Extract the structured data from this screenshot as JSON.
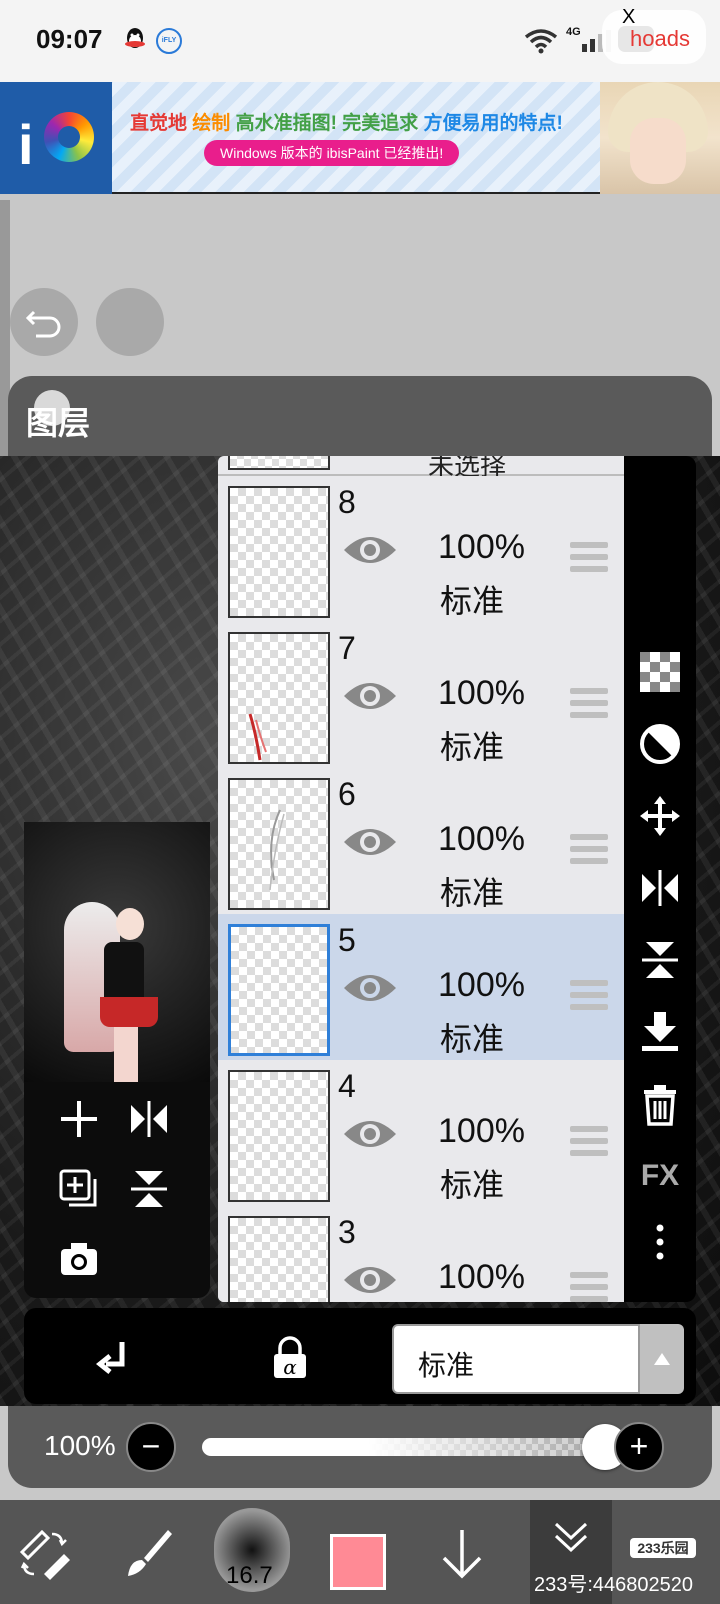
{
  "status_bar": {
    "time": "09:07",
    "network": "4G",
    "ad_close": "X",
    "ad_label": "hoads"
  },
  "ad_banner": {
    "headline_parts": [
      "直觉地",
      "绘制",
      "高水准插图!",
      "完美追求",
      "方便易用的特点!"
    ],
    "subline": "Windows 版本的 ibisPaint 已经推出!",
    "logo_letters": "iP"
  },
  "layer_panel": {
    "title": "图层",
    "top_partial_label": "未选择",
    "layers": [
      {
        "number": "8",
        "opacity": "100%",
        "blend": "标准",
        "selected": false
      },
      {
        "number": "7",
        "opacity": "100%",
        "blend": "标准",
        "selected": false
      },
      {
        "number": "6",
        "opacity": "100%",
        "blend": "标准",
        "selected": false
      },
      {
        "number": "5",
        "opacity": "100%",
        "blend": "标准",
        "selected": true
      },
      {
        "number": "4",
        "opacity": "100%",
        "blend": "标准",
        "selected": false
      },
      {
        "number": "3",
        "opacity": "100%",
        "blend": "标准",
        "selected": false
      }
    ],
    "right_tools": [
      "checker-icon",
      "half-circle-icon",
      "move-icon",
      "flip-horizontal-icon",
      "flip-vertical-icon",
      "merge-down-icon",
      "trash-icon",
      "fx-icon",
      "more-icon"
    ],
    "fx_label": "FX",
    "left_tools": [
      "add-layer-icon",
      "flip-layer-horizontal-icon",
      "duplicate-layer-icon",
      "flip-layer-vertical-icon",
      "camera-icon"
    ]
  },
  "blend_bar": {
    "blend_mode": "标准"
  },
  "opacity_slider": {
    "label": "100%",
    "value": 1.0,
    "minus": "−",
    "plus": "+"
  },
  "bottom_toolbar": {
    "brush_size": "16.7",
    "color": "#ff8a95",
    "watermark_badge": "233乐园",
    "watermark_text": "233号:446802520"
  }
}
